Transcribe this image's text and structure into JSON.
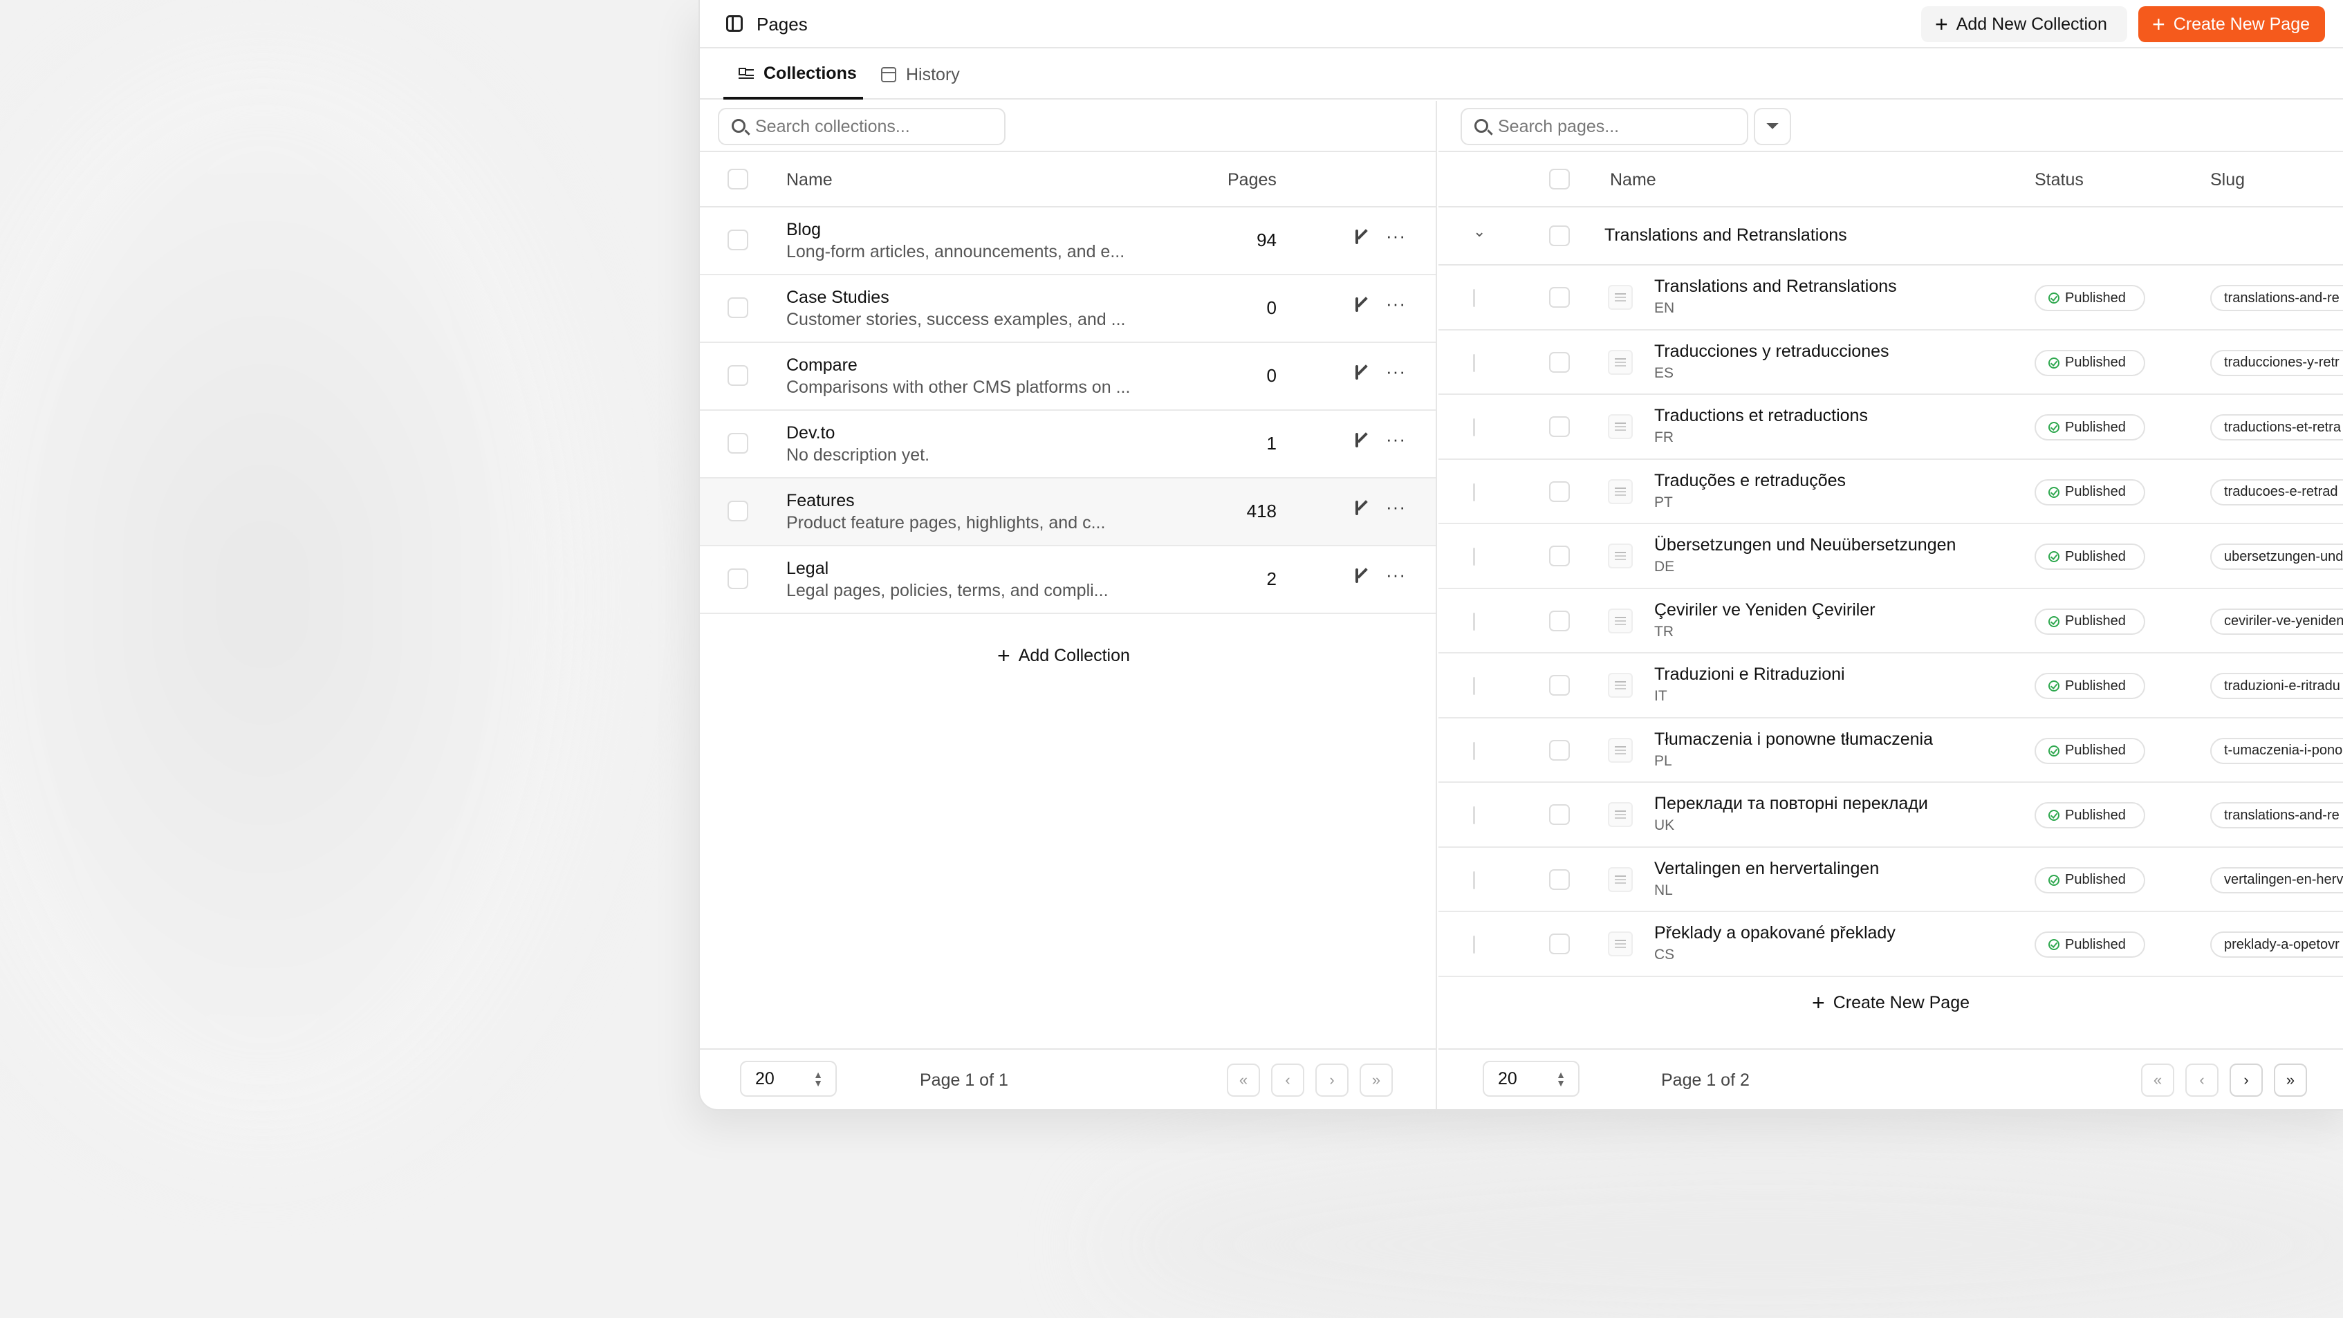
{
  "header": {
    "title": "Pages",
    "add_collection_label": "Add New Collection",
    "create_page_label": "Create New Page",
    "accent": "#f55a1c"
  },
  "tabs": [
    {
      "label": "Collections",
      "icon": "list-icon",
      "active": true
    },
    {
      "label": "History",
      "icon": "calendar-icon",
      "active": false
    }
  ],
  "collections": {
    "search_placeholder": "Search collections...",
    "columns": {
      "name": "Name",
      "pages": "Pages"
    },
    "rows": [
      {
        "name": "Blog",
        "description": "Long-form articles, announcements, and e...",
        "pages": "94"
      },
      {
        "name": "Case Studies",
        "description": "Customer stories, success examples, and ...",
        "pages": "0"
      },
      {
        "name": "Compare",
        "description": "Comparisons with other CMS platforms on ...",
        "pages": "0"
      },
      {
        "name": "Dev.to",
        "description": "No description yet.",
        "pages": "1"
      },
      {
        "name": "Features",
        "description": "Product feature pages, highlights, and c...",
        "pages": "418"
      },
      {
        "name": "Legal",
        "description": "Legal pages, policies, terms, and compli...",
        "pages": "2"
      }
    ],
    "add_label": "Add Collection",
    "footer": {
      "page_size": "20",
      "page_info": "Page 1 of 1"
    }
  },
  "pages": {
    "search_placeholder": "Search pages...",
    "columns": {
      "name": "Name",
      "status": "Status",
      "slug": "Slug"
    },
    "group": "Translations and Retranslations",
    "rows": [
      {
        "name": "Translations and Retranslations",
        "lang": "EN",
        "status": "Published",
        "slug": "translations-and-re"
      },
      {
        "name": "Traducciones y retraducciones",
        "lang": "ES",
        "status": "Published",
        "slug": "traducciones-y-retr"
      },
      {
        "name": "Traductions et retraductions",
        "lang": "FR",
        "status": "Published",
        "slug": "traductions-et-retra"
      },
      {
        "name": "Traduções e retraduções",
        "lang": "PT",
        "status": "Published",
        "slug": "traducoes-e-retrad"
      },
      {
        "name": "Übersetzungen und Neuübersetzungen",
        "lang": "DE",
        "status": "Published",
        "slug": "ubersetzungen-und"
      },
      {
        "name": "Çeviriler ve Yeniden Çeviriler",
        "lang": "TR",
        "status": "Published",
        "slug": "ceviriler-ve-yeniden"
      },
      {
        "name": "Traduzioni e Ritraduzioni",
        "lang": "IT",
        "status": "Published",
        "slug": "traduzioni-e-ritradu"
      },
      {
        "name": "Tłumaczenia i ponowne tłumaczenia",
        "lang": "PL",
        "status": "Published",
        "slug": "t-umaczenia-i-pono"
      },
      {
        "name": "Переклади та повторні переклади",
        "lang": "UK",
        "status": "Published",
        "slug": "translations-and-re"
      },
      {
        "name": "Vertalingen en hervertalingen",
        "lang": "NL",
        "status": "Published",
        "slug": "vertalingen-en-herv"
      },
      {
        "name": "Překlady a opakované překlady",
        "lang": "CS",
        "status": "Published",
        "slug": "preklady-a-opetovr"
      }
    ],
    "create_label": "Create New Page",
    "footer": {
      "page_size": "20",
      "page_info": "Page 1 of 2"
    }
  }
}
